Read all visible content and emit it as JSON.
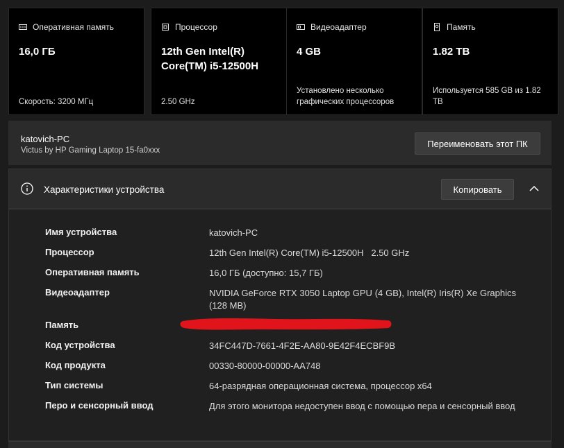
{
  "cards": [
    {
      "icon": "ram-icon",
      "label": "Оперативная память",
      "value": "16,0 ГБ",
      "foot": "Скорость: 3200 МГц"
    },
    {
      "icon": "cpu-icon",
      "label": "Процессор",
      "value": "12th Gen Intel(R) Core(TM) i5-12500H",
      "foot": "2.50 GHz"
    },
    {
      "icon": "gpu-icon",
      "label": "Видеоадаптер",
      "value": "4 GB",
      "foot": "Установлено несколько графических процессоров"
    },
    {
      "icon": "storage-icon",
      "label": "Память",
      "value": "1.82 TB",
      "foot": "Используется 585 GB из 1.82 TB"
    }
  ],
  "device": {
    "name": "katovich-PC",
    "model": "Victus by HP Gaming Laptop 15-fa0xxx",
    "rename_label": "Переименовать этот ПК"
  },
  "specs": {
    "title": "Характеристики устройства",
    "copy_label": "Копировать",
    "rows": [
      {
        "key": "Имя устройства",
        "value": "katovich-PC"
      },
      {
        "key": "Процессор",
        "value": "12th Gen Intel(R) Core(TM) i5-12500H   2.50 GHz"
      },
      {
        "key": "Оперативная память",
        "value": "16,0 ГБ (доступно: 15,7 ГБ)"
      },
      {
        "key": "Видеоадаптер",
        "value": "NVIDIA GeForce RTX 3050 Laptop GPU (4 GB), Intel(R) Iris(R) Xe Graphics (128 MB)"
      },
      {
        "key": "Память",
        "value": ""
      },
      {
        "key": "Код устройства",
        "value": "34FC447D-7661-4F2E-AA80-9E42F4ECBF9B"
      },
      {
        "key": "Код продукта",
        "value": "00330-80000-00000-AA748"
      },
      {
        "key": "Тип системы",
        "value": "64-разрядная операционная система, процессор x64"
      },
      {
        "key": "Перо и сенсорный ввод",
        "value": "Для этого монитора недоступен ввод с помощью пера и сенсорный ввод"
      }
    ]
  },
  "colors": {
    "background": "#1c1c1c",
    "card": "#000000",
    "panel": "#2b2b2b",
    "button": "#3c3c3c",
    "redaction": "#e0141a"
  }
}
